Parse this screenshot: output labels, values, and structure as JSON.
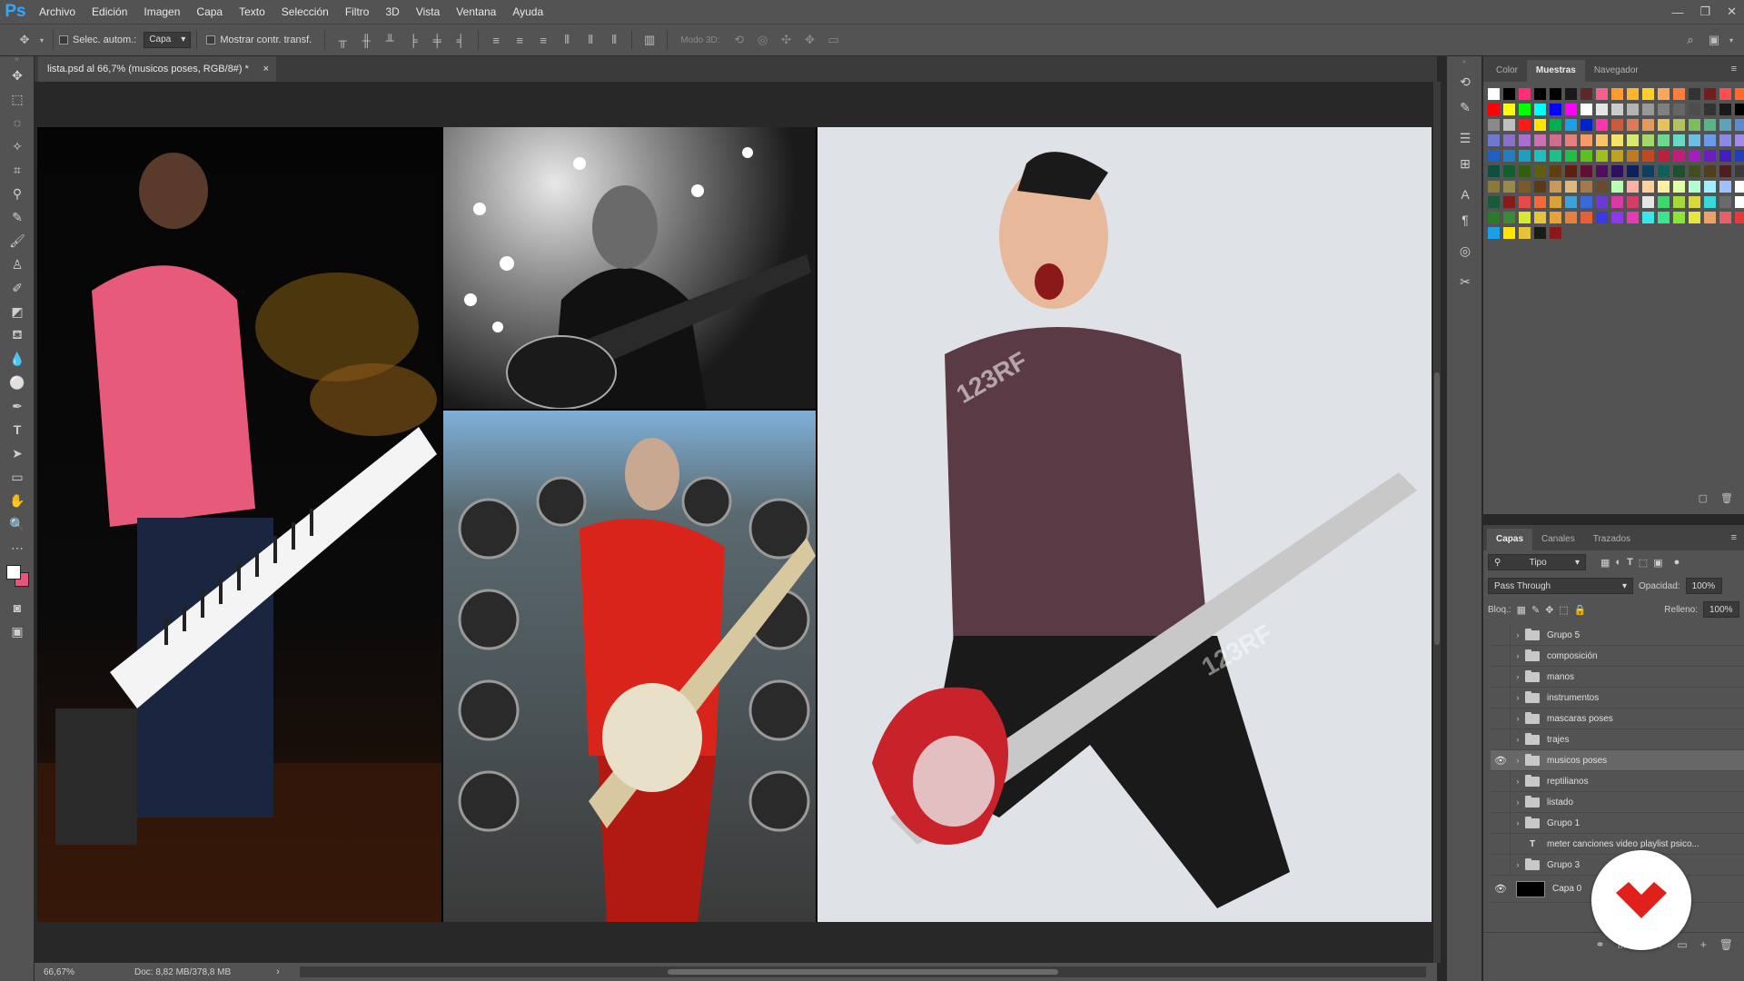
{
  "app": {
    "logo": "Ps",
    "brand_color": "#31a8ff"
  },
  "menu": [
    "Archivo",
    "Edición",
    "Imagen",
    "Capa",
    "Texto",
    "Selección",
    "Filtro",
    "3D",
    "Vista",
    "Ventana",
    "Ayuda"
  ],
  "window_controls": [
    "—",
    "❐",
    "✕"
  ],
  "options": {
    "auto_select_label": "Selec. autom.:",
    "auto_select_target": "Capa",
    "show_transform_label": "Mostrar contr. transf.",
    "mode_3d_label": "Modo 3D:"
  },
  "document": {
    "tab_title": "lista.psd al 66,7% (musicos poses, RGB/8#) *",
    "close": "×",
    "zoom": "66,67%",
    "doc_size": "Doc: 8,82 MB/378,8 MB"
  },
  "top_panel": {
    "tabs": [
      "Color",
      "Muestras",
      "Navegador"
    ],
    "active_tab": "Muestras",
    "swatches": [
      "#ffffff",
      "#000000",
      "#ff2d7a",
      "#000000",
      "#000000",
      "#1a1a1a",
      "#5a2a2a",
      "#f7608c",
      "#ff9c2d",
      "#ffb42d",
      "#ffd02d",
      "#ffa65a",
      "#ff7d3c",
      "#333333",
      "#6e1f1f",
      "#ff4d4d",
      "#ff6a2d",
      "#ff0000",
      "#ffff00",
      "#00ff00",
      "#00ffff",
      "#0000ff",
      "#ff00ff",
      "#ffffff",
      "#e6e6e6",
      "#cccccc",
      "#b3b3b3",
      "#999999",
      "#808080",
      "#666666",
      "#4d4d4d",
      "#333333",
      "#1a1a1a",
      "#000000",
      "#8a8a8a",
      "#bfbfbf",
      "#ff1a1a",
      "#ffe600",
      "#00b050",
      "#1aa0e6",
      "#0022cc",
      "#ff33aa",
      "#cc5a3d",
      "#e07a55",
      "#e39a5c",
      "#e6c15c",
      "#b3c25c",
      "#7abf5c",
      "#5cb38a",
      "#5ca3bf",
      "#5c8acc",
      "#6f78cc",
      "#8a6fcc",
      "#a86fcc",
      "#cc6fb3",
      "#cc6f8a",
      "#e68080",
      "#f59a6b",
      "#f7c36b",
      "#f7e16b",
      "#d9e86b",
      "#a3d96b",
      "#6bd98a",
      "#6bd9c2",
      "#6bbfe6",
      "#6b9ae6",
      "#8a8ae6",
      "#a38ae6",
      "#1f5fbf",
      "#1f7fbf",
      "#1f9fbf",
      "#1fbfbf",
      "#1fbf8a",
      "#1fbf4a",
      "#5fbf1f",
      "#9fbf1f",
      "#bfa31f",
      "#bf7a1f",
      "#bf4a1f",
      "#bf1f3f",
      "#bf1f7a",
      "#9f1fbf",
      "#6a1fbf",
      "#3f1fbf",
      "#1f3fbf",
      "#0f4f3f",
      "#0f5f2f",
      "#2f5f0f",
      "#5f5f0f",
      "#5f3f0f",
      "#5f1f0f",
      "#5f0f2f",
      "#4f0f5f",
      "#2f0f5f",
      "#0f1f5f",
      "#0f3f5f",
      "#0f5f5f",
      "#1f4f2f",
      "#3f4f1f",
      "#4f3f1f",
      "#4f1f1f",
      "#3a3a3a",
      "#8a7a3a",
      "#9a8a4a",
      "#7a5a2a",
      "#5a3a1a",
      "#c79a5a",
      "#e0b87a",
      "#a37a4a",
      "#6a4a2a",
      "#b8ffb0",
      "#ffb0a0",
      "#ffd0a0",
      "#fff0a0",
      "#e0ffa0",
      "#b0ffd0",
      "#a0f0ff",
      "#a0c0ff",
      "#ffffff",
      "#1a5a3a",
      "#8a1a1a",
      "#e64a4a",
      "#f26a3a",
      "#d9a33a",
      "#3aa3d9",
      "#3a6ad9",
      "#6a3ad9",
      "#d93aa3",
      "#d93a6a",
      "#e6e6e6",
      "#3ad96a",
      "#a3d93a",
      "#d9d93a",
      "#3ad9d9",
      "#6a6a6a",
      "#ffffff",
      "#2a7a2a",
      "#3a8a3a",
      "#d9e63a",
      "#e6c33a",
      "#e6a33a",
      "#e6803a",
      "#e6603a",
      "#3a3ae6",
      "#8a3ae6",
      "#e63ab3",
      "#3ae6e6",
      "#3ae68a",
      "#8ae63a",
      "#e6e63a",
      "#e6a36a",
      "#e6606a",
      "#e63a3a",
      "#1aa0e6",
      "#ffe600",
      "#e6c33a",
      "#1a1a1a",
      "#8a1a1a"
    ]
  },
  "layers_panel": {
    "tabs": [
      "Capas",
      "Canales",
      "Trazados"
    ],
    "active_tab": "Capas",
    "filter_kind": "Tipo",
    "blend_mode": "Pass Through",
    "opacity_label": "Opacidad:",
    "opacity_value": "100%",
    "lock_label": "Bloq.:",
    "fill_label": "Relleno:",
    "fill_value": "100%",
    "layers": [
      {
        "name": "Grupo 5",
        "type": "group",
        "visible": false,
        "selected": false
      },
      {
        "name": "composición",
        "type": "group",
        "visible": false,
        "selected": false
      },
      {
        "name": "manos",
        "type": "group",
        "visible": false,
        "selected": false
      },
      {
        "name": "instrumentos",
        "type": "group",
        "visible": false,
        "selected": false
      },
      {
        "name": "mascaras poses",
        "type": "group",
        "visible": false,
        "selected": false
      },
      {
        "name": "trajes",
        "type": "group",
        "visible": false,
        "selected": false
      },
      {
        "name": "musicos poses",
        "type": "group",
        "visible": true,
        "selected": true
      },
      {
        "name": "reptilianos",
        "type": "group",
        "visible": false,
        "selected": false
      },
      {
        "name": "listado",
        "type": "group",
        "visible": false,
        "selected": false
      },
      {
        "name": "Grupo 1",
        "type": "group",
        "visible": false,
        "selected": false
      },
      {
        "name": "meter canciones video playlist psico...",
        "type": "text",
        "visible": false,
        "selected": false
      },
      {
        "name": "Grupo 3",
        "type": "group",
        "visible": false,
        "selected": false
      },
      {
        "name": "Capa 0",
        "type": "pixel",
        "visible": true,
        "selected": false
      }
    ],
    "footer_icons": [
      "link-icon",
      "fx-icon",
      "mask-icon",
      "adjustment-icon",
      "new-group-icon",
      "new-layer-icon",
      "trash-icon"
    ],
    "footer_glyphs": [
      "⚭",
      "fx",
      "◙",
      "◐",
      "▭",
      "+",
      "🗑"
    ]
  },
  "watermark": {
    "text": "123RF"
  },
  "colors": {
    "accent": "#31a8ff",
    "badge_red": "#e0201b",
    "fg_swatch": "#ffffff",
    "bg_swatch": "#e8557a"
  }
}
